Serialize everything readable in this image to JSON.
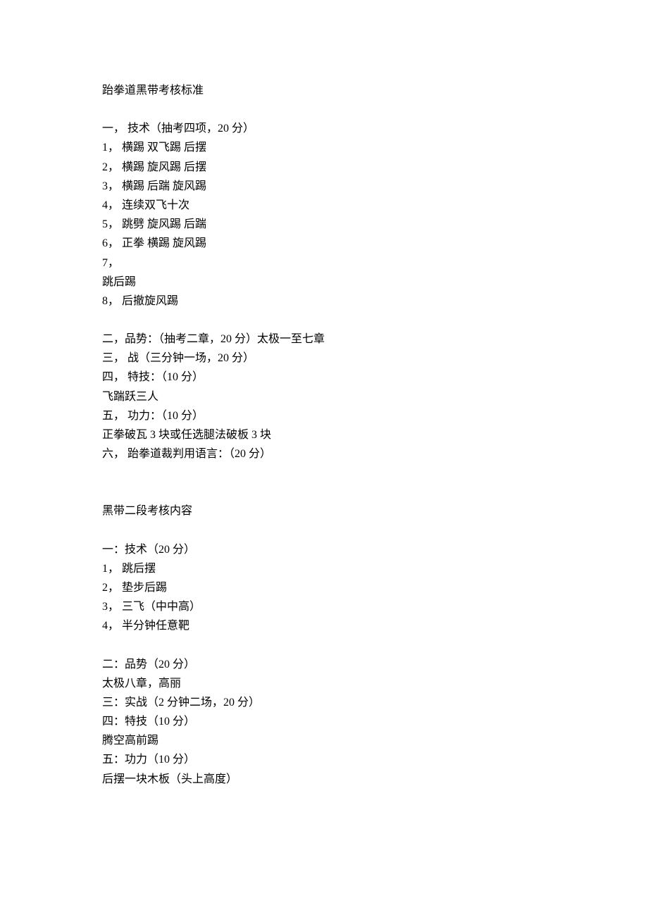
{
  "doc": {
    "title": "跆拳道黑带考核标准",
    "section1": {
      "header": "一，  技术（抽考四项，20 分）",
      "items": [
        "1，  横踢  双飞踢  后摆",
        "2，  横踢  旋风踢  后摆",
        "3，  横踢  后踹  旋风踢",
        "4，  连续双飞十次",
        "5，  跳劈  旋风踢  后踹",
        "6，  正拳  横踢  旋风踢",
        "7，",
        "跳后踢",
        "8，  后撤旋风踢"
      ]
    },
    "section2": "二，品势：（抽考二章，20 分）太极一至七章",
    "section3": "三，  战（三分钟一场，20 分）",
    "section4": {
      "header": "四，  特技：（10 分）",
      "content": "飞踹跃三人"
    },
    "section5": {
      "header": "五，  功力：（10 分）",
      "content": "正拳破瓦 3 块或任选腿法破板 3 块"
    },
    "section6": "六，  跆拳道裁判用语言：（20 分）",
    "part2title": "黑带二段考核内容",
    "p2section1": {
      "header": "一：技术（20 分）",
      "items": [
        "1，  跳后摆",
        "2，  垫步后踢",
        "3，  三飞（中中高）",
        "4，  半分钟任意靶"
      ]
    },
    "p2section2": {
      "header": "二：品势（20 分）",
      "content": "太极八章，高丽"
    },
    "p2section3": "三：实战（2 分钟二场，20 分）",
    "p2section4": {
      "header": "四：特技（10 分）",
      "content": "腾空高前踢"
    },
    "p2section5": {
      "header": "五：功力（10 分）",
      "content": "后摆一块木板（头上高度）"
    }
  }
}
